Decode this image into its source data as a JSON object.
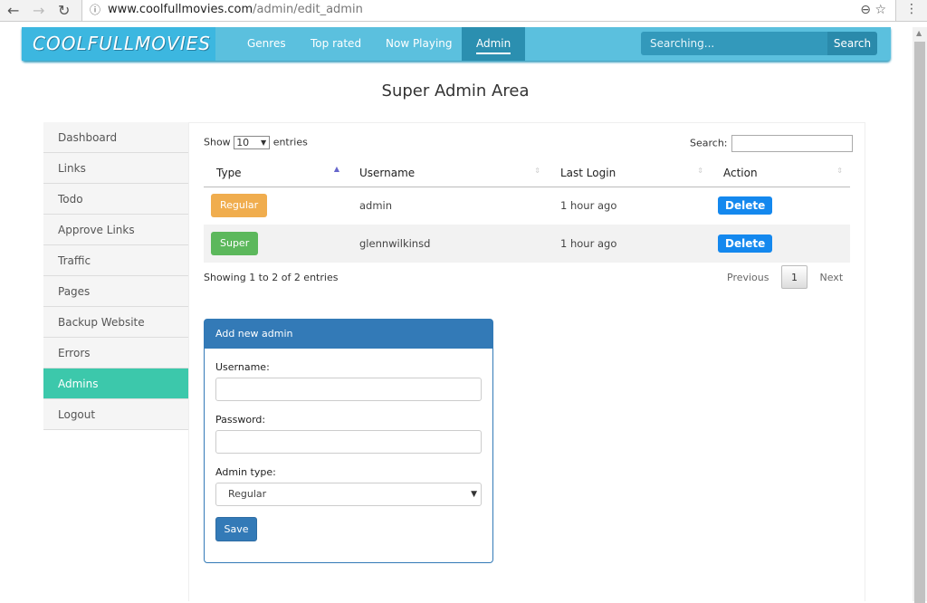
{
  "browser": {
    "url_host": "www.coolfullmovies.com",
    "url_path": "/admin/edit_admin"
  },
  "nav": {
    "logo": "COOLFULLMOVIES",
    "items": [
      "Genres",
      "Top rated",
      "Now Playing",
      "Admin"
    ],
    "search_placeholder": "Searching...",
    "search_button": "Search"
  },
  "page_title": "Super Admin Area",
  "sidebar": {
    "items": [
      "Dashboard",
      "Links",
      "Todo",
      "Approve Links",
      "Traffic",
      "Pages",
      "Backup Website",
      "Errors",
      "Admins",
      "Logout"
    ],
    "active": "Admins"
  },
  "table": {
    "show_label": "Show",
    "entries_label": "entries",
    "page_size": "10",
    "search_label": "Search:",
    "columns": [
      "Type",
      "Username",
      "Last Login",
      "Action"
    ],
    "rows": [
      {
        "type": "Regular",
        "type_color": "#f0ad4e",
        "username": "admin",
        "last_login": "1 hour ago",
        "action": "Delete"
      },
      {
        "type": "Super",
        "type_color": "#5cb85c",
        "username": "glennwilkinsd",
        "last_login": "1 hour ago",
        "action": "Delete"
      }
    ],
    "info": "Showing 1 to 2 of 2 entries",
    "pager": {
      "previous": "Previous",
      "current": "1",
      "next": "Next"
    }
  },
  "form": {
    "title": "Add new admin",
    "username_label": "Username:",
    "password_label": "Password:",
    "type_label": "Admin type:",
    "type_value": "Regular",
    "save": "Save"
  }
}
